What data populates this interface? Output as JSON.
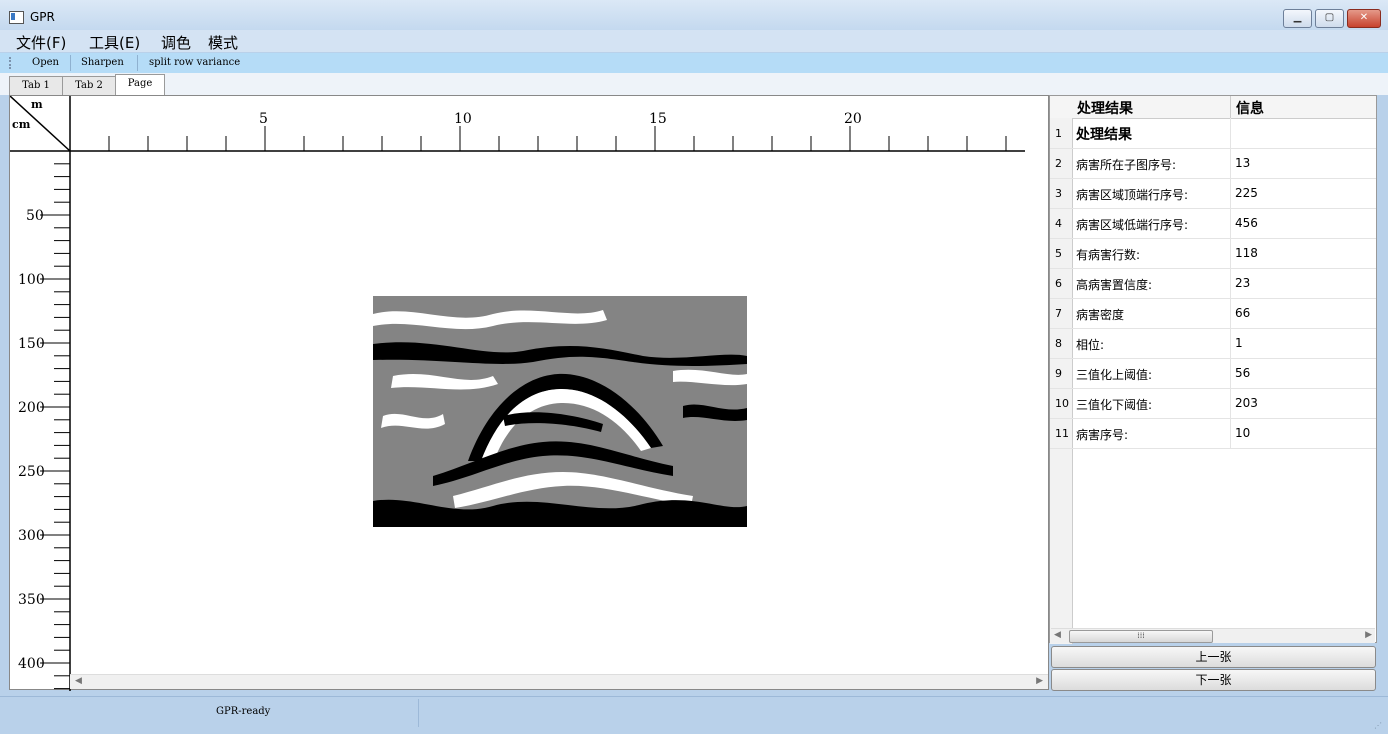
{
  "window": {
    "title": "GPR",
    "min_label": "▁",
    "max_label": "▢",
    "close_label": "✕"
  },
  "menu": [
    "文件(F)",
    "工具(E)",
    "调色",
    "模式"
  ],
  "toolbar": [
    "Open",
    "Sharpen",
    "split row variance"
  ],
  "tabs": [
    {
      "label": "Tab 1",
      "active": false
    },
    {
      "label": "Tab 2",
      "active": false
    },
    {
      "label": "Page",
      "active": true
    }
  ],
  "ruler": {
    "corner_top": "m",
    "corner_left": "cm",
    "top_labels": [
      "5",
      "10",
      "15",
      "20"
    ],
    "left_labels": [
      "50",
      "100",
      "150",
      "200",
      "250",
      "300",
      "350",
      "400"
    ]
  },
  "results": {
    "headers": [
      "处理结果",
      "信息"
    ],
    "rows": [
      {
        "n": "1",
        "key": "处理结果",
        "value": "",
        "bold": true
      },
      {
        "n": "2",
        "key": "病害所在子图序号:",
        "value": "13"
      },
      {
        "n": "3",
        "key": "病害区域顶端行序号:",
        "value": "225"
      },
      {
        "n": "4",
        "key": "病害区域低端行序号:",
        "value": "456"
      },
      {
        "n": "5",
        "key": "有病害行数:",
        "value": "118"
      },
      {
        "n": "6",
        "key": "高病害置信度:",
        "value": "23"
      },
      {
        "n": "7",
        "key": "病害密度",
        "value": "66"
      },
      {
        "n": "8",
        "key": "相位:",
        "value": "1"
      },
      {
        "n": "9",
        "key": "三值化上阈值:",
        "value": "56"
      },
      {
        "n": "10",
        "key": "三值化下阈值:",
        "value": "203"
      },
      {
        "n": "11",
        "key": "病害序号:",
        "value": "10"
      }
    ]
  },
  "buttons": {
    "prev": "上一张",
    "next": "下一张"
  },
  "status": {
    "text": "GPR-ready"
  }
}
